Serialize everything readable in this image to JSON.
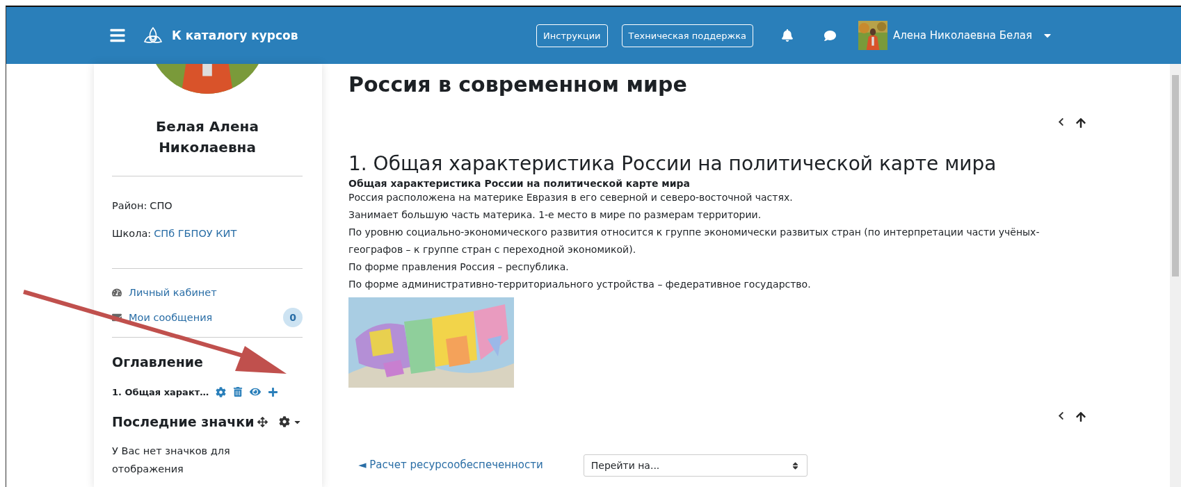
{
  "navbar": {
    "brand": "К каталогу курсов",
    "buttons": [
      "Инструкции",
      "Техническая поддержка"
    ],
    "user_name": "Алена Николаевна Белая"
  },
  "sidebar": {
    "name": "Белая Алена Николаевна",
    "info": [
      {
        "label": "Район:",
        "value": "СПО",
        "kind": "text"
      },
      {
        "label": "Школа:",
        "value": "СПб ГБПОУ КИТ",
        "kind": "link"
      }
    ],
    "links": [
      {
        "label": "Личный кабинет",
        "kind": "dashboard"
      },
      {
        "label": "Мои сообщения",
        "kind": "messages",
        "badge": "0"
      }
    ],
    "toc": {
      "title": "Оглавление",
      "items": [
        {
          "label": "1. Общая характ…"
        }
      ]
    },
    "badges_block": {
      "title": "Последние значки",
      "text": "У Вас нет значков для отображения"
    }
  },
  "main": {
    "title": "Россия в современном мире",
    "chapter_title": "1. Общая характеристика России на политической карте мира",
    "lead": "Общая характеристика России на политической карте мира",
    "lines": [
      "Россия расположена на материке Евразия в его северной и северо-восточной частях.",
      "Занимает большую часть материка. 1-е место в мире по размерам территории.",
      "По уровню социально-экономического развития относится к группе экономически развитых стран (по интерпретации части учёных-географов – к группе стран с переходной экономикой).",
      "По форме правления Россия – республика.",
      "По форме административно-территориального устройства – федеративное государство."
    ],
    "prev_link": "◄ Расчет ресурсообеспеченности",
    "jump_select": {
      "placeholder": "Перейти на..."
    }
  }
}
